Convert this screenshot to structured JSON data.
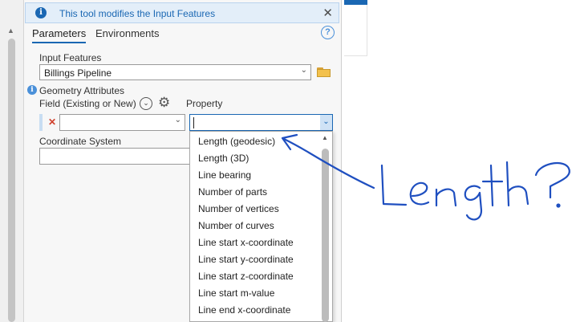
{
  "info_banner": {
    "message": "This tool modifies the Input Features",
    "info_icon": "info-icon",
    "close_icon": "close-icon",
    "close_glyph": "✕"
  },
  "tabs": [
    {
      "label": "Parameters",
      "active": true
    },
    {
      "label": "Environments",
      "active": false
    }
  ],
  "help_icon": "?",
  "input_features": {
    "label": "Input Features",
    "value": "Billings Pipeline"
  },
  "geometry_attributes": {
    "label": "Geometry Attributes",
    "field_label": "Field (Existing or New)",
    "property_label": "Property",
    "field_value": "",
    "property_value": ""
  },
  "coordinate_system": {
    "label": "Coordinate System",
    "value": ""
  },
  "property_dropdown": {
    "options": [
      "Length (geodesic)",
      "Length (3D)",
      "Line bearing",
      "Number of parts",
      "Number of vertices",
      "Number of curves",
      "Line start x-coordinate",
      "Line start y-coordinate",
      "Line start z-coordinate",
      "Line start m-value",
      "Line end x-coordinate"
    ]
  },
  "handwritten_note": "Length?",
  "colors": {
    "accent": "#1a67b3",
    "banner_bg": "#e3eef9",
    "ink": "#1f4fc0",
    "delete": "#d0402c"
  }
}
